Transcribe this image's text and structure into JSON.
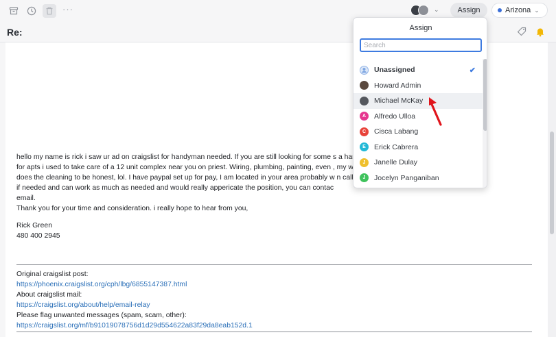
{
  "toolbar": {
    "icons": [
      "archive-icon",
      "clock-icon",
      "trash-icon",
      "more-icon"
    ],
    "more_label": "···",
    "assign_label": "Assign",
    "team_label": "Arizona",
    "team_color": "#3b6fd8"
  },
  "conversation": {
    "subject": "Re:"
  },
  "email": {
    "lines": [
      "hello my name is rick i saw ur ad on craigslist for handyman needed. If you are still  looking for some                                                         s a handyman",
      "for apts i used to take care of a 12 unit complex near you on priest. Wiring, plumbing, painting, even                                                         , my wife",
      "does the cleaning to be honest, lol. I have paypal set up for pay, I am located in your area probably w                                                         n call 24 hrs",
      "if needed and can work as much as needed and would really appericate the position, you can contac",
      "email.",
      "Thank you for your time and consideration. i really hope to hear from you,"
    ],
    "signature_name": "Rick Green",
    "signature_phone": "480 400 2945",
    "original_post_label": "Original craigslist post:",
    "original_post_link": "https://phoenix.craigslist.org/cph/lbg/6855147387.html",
    "about_label": "About craigslist mail:",
    "about_link": "https://craigslist.org/about/help/email-relay",
    "flag_label": "Please flag unwanted messages (spam, scam, other):",
    "flag_link": "https://craigslist.org/mf/b91019078756d1d29d554622a83f29da8eab152d.1"
  },
  "assign_dropdown": {
    "title": "Assign",
    "search_placeholder": "Search",
    "items": [
      {
        "name": "Unassigned",
        "selected": true,
        "avatar_color": "#bcd3f2",
        "initial": ""
      },
      {
        "name": "Howard Admin",
        "selected": false,
        "avatar_color": "#5b4a3f",
        "initial": ""
      },
      {
        "name": "Michael McKay",
        "selected": false,
        "avatar_color": "#55585e",
        "initial": ""
      },
      {
        "name": "Alfredo Ulloa",
        "selected": false,
        "avatar_color": "#e5368f",
        "initial": "A"
      },
      {
        "name": "Cisca Labang",
        "selected": false,
        "avatar_color": "#e8433a",
        "initial": "C"
      },
      {
        "name": "Erick Cabrera",
        "selected": false,
        "avatar_color": "#22b8d6",
        "initial": "E"
      },
      {
        "name": "Janelle Dulay",
        "selected": false,
        "avatar_color": "#efc02e",
        "initial": "J"
      },
      {
        "name": "Jocelyn Panganiban",
        "selected": false,
        "avatar_color": "#3fc25c",
        "initial": "J"
      }
    ]
  },
  "colors": {
    "accent": "#3e7be0",
    "link": "#2a6fb8",
    "arrow": "#e0151c",
    "bell": "#f2b705"
  }
}
